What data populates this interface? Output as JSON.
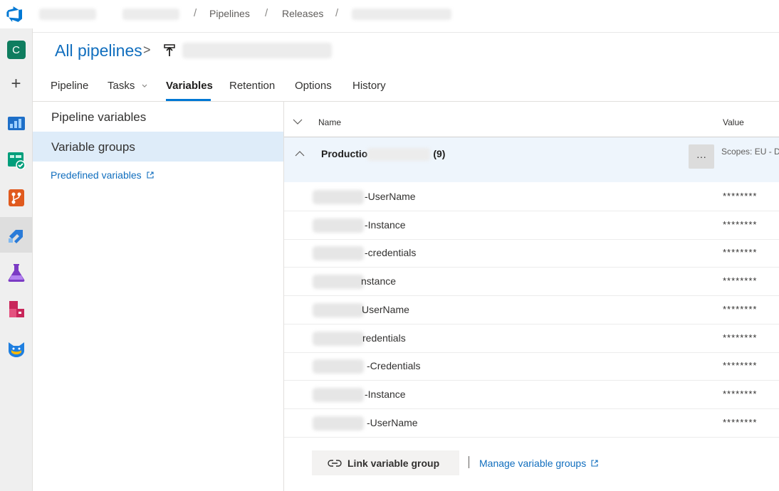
{
  "breadcrumb": {
    "pipelines": "Pipelines",
    "releases": "Releases",
    "separator": "/"
  },
  "rail": {
    "project_initial": "C",
    "add_glyph": "+"
  },
  "header": {
    "title": "All pipelines",
    "chevron": ">"
  },
  "tabs": [
    {
      "label": "Pipeline"
    },
    {
      "label": "Tasks"
    },
    {
      "label": "Variables"
    },
    {
      "label": "Retention"
    },
    {
      "label": "Options"
    },
    {
      "label": "History"
    }
  ],
  "sidebar": {
    "pipeline_variables": "Pipeline variables",
    "variable_groups": "Variable groups",
    "predefined_variables": "Predefined variables"
  },
  "table": {
    "col_name": "Name",
    "col_value": "Value",
    "group": {
      "name": "Productio",
      "count": "(9)",
      "more": "···",
      "scopes": "Scopes: EU - D"
    },
    "rows": [
      {
        "name": "-UserName",
        "value": "********"
      },
      {
        "name": "-Instance",
        "value": "********"
      },
      {
        "name": "-credentials",
        "value": "********"
      },
      {
        "name": "nstance",
        "value": "********"
      },
      {
        "name": "UserName",
        "value": "********"
      },
      {
        "name": "redentials",
        "value": "********"
      },
      {
        "name": "-Credentials",
        "value": "********"
      },
      {
        "name": "-Instance",
        "value": "********"
      },
      {
        "name": "-UserName",
        "value": "********"
      }
    ]
  },
  "actions": {
    "link_group": "Link variable group",
    "manage_groups": "Manage variable groups"
  },
  "colors": {
    "accent": "#0078d4",
    "link": "#106ebe",
    "selected_bg": "#deecf9"
  }
}
